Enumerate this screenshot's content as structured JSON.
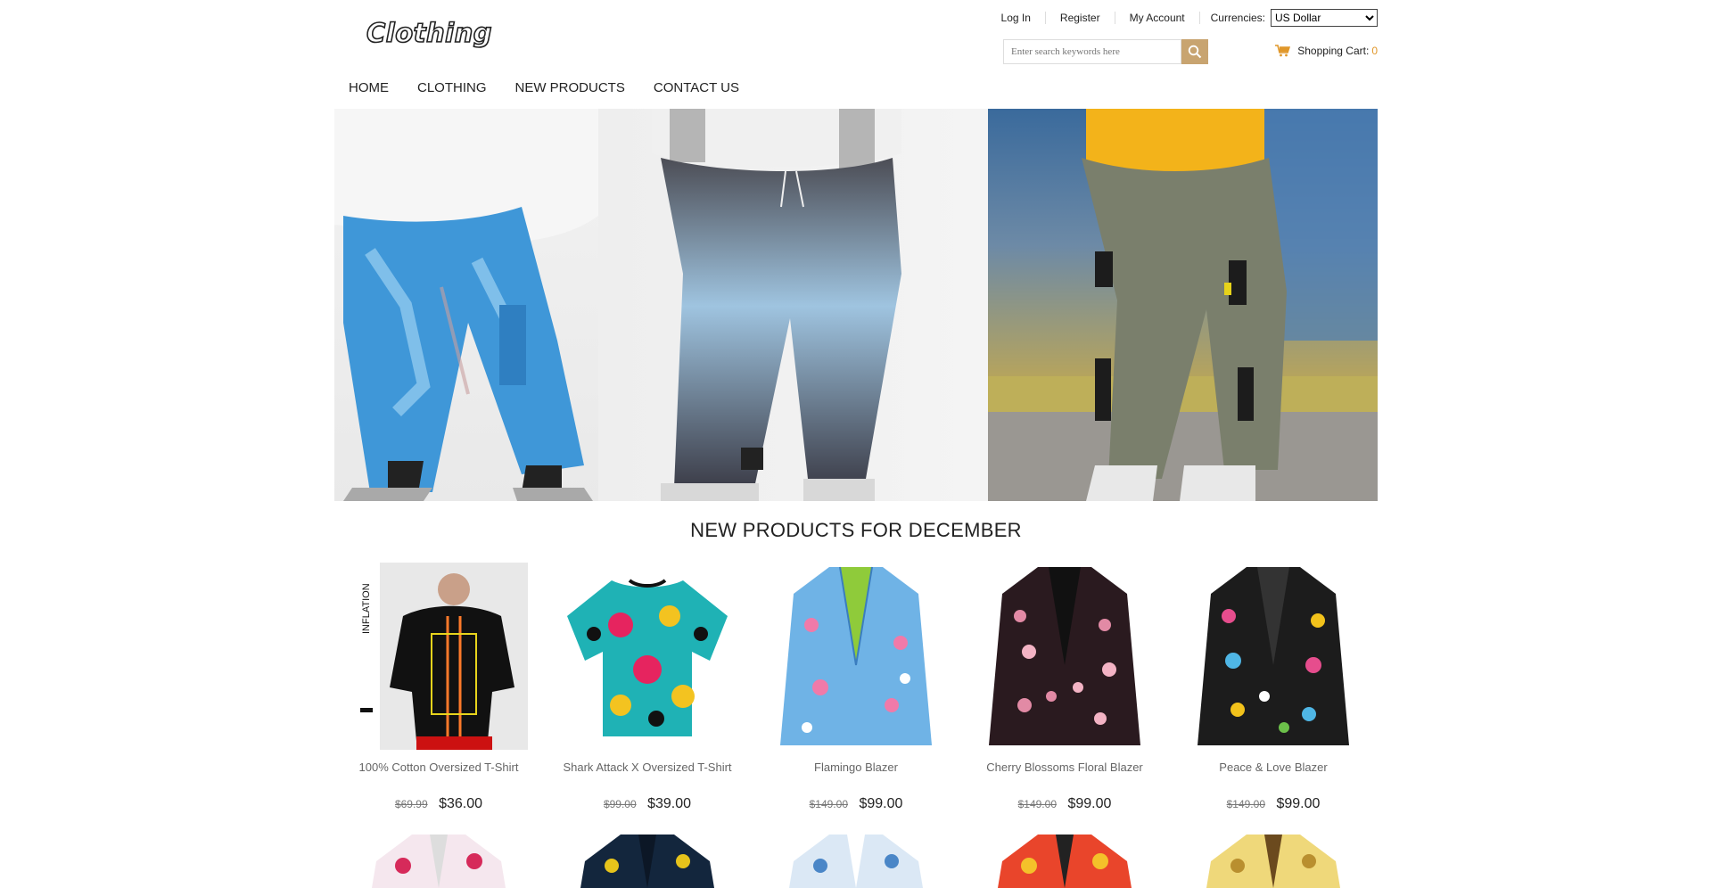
{
  "header": {
    "logo_text": "Clothing",
    "links": [
      "Log In",
      "Register",
      "My Account"
    ],
    "currencies_label": "Currencies:",
    "currency_selected": "US Dollar",
    "search_placeholder": "Enter search keywords here",
    "cart_label": "Shopping Cart:",
    "cart_count": "0"
  },
  "nav": [
    "HOME",
    "CLOTHING",
    "NEW PRODUCTS",
    "CONTACT US"
  ],
  "banner_icons": [
    "tie-dye-pants-image",
    "gradient-jogger-image",
    "cargo-pants-image"
  ],
  "section": {
    "title": "NEW PRODUCTS FOR DECEMBER"
  },
  "products": [
    {
      "name": "100% Cotton Oversized T-Shirt",
      "old_price": "$69.99",
      "price": "$36.00",
      "side_text": "INFLATION"
    },
    {
      "name": "Shark Attack X Oversized T-Shirt",
      "old_price": "$99.00",
      "price": "$39.00"
    },
    {
      "name": "Flamingo Blazer",
      "old_price": "$149.00",
      "price": "$99.00"
    },
    {
      "name": "Cherry Blossoms Floral Blazer",
      "old_price": "$149.00",
      "price": "$99.00"
    },
    {
      "name": "Peace & Love Blazer",
      "old_price": "$149.00",
      "price": "$99.00"
    }
  ],
  "colors": {
    "accent": "#c8a470",
    "cart_count": "#e0972a"
  }
}
